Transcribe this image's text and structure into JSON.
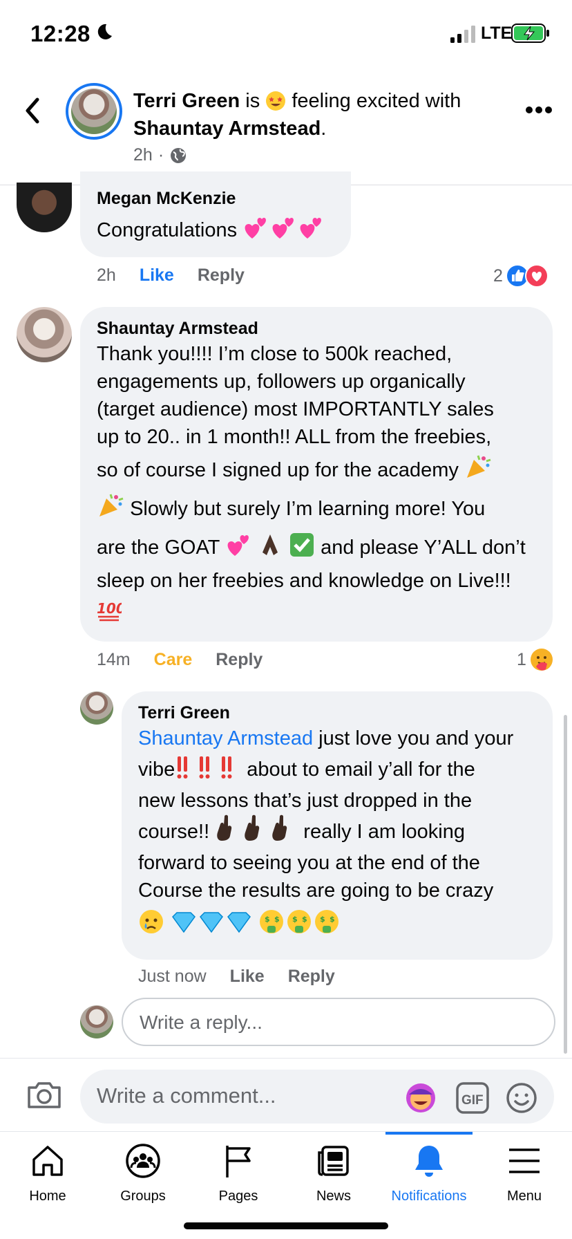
{
  "status_bar": {
    "time": "12:28",
    "network": "LTE"
  },
  "header": {
    "author": "Terri Green",
    "connector": "is",
    "feeling": "feeling excited with",
    "tagged": "Shauntay Armstead",
    "meta_time": "2h",
    "dot": "·"
  },
  "comments": [
    {
      "name": "Megan McKenzie",
      "text": "Congratulations",
      "time": "2h",
      "like": "Like",
      "reply": "Reply",
      "reaction_count": "2"
    },
    {
      "name": "Shauntay Armstead",
      "lines": [
        "Thank you!!!! I’m close to 500k reached,",
        "engagements up, followers up organically",
        "(target audience) most IMPORTANTLY sales",
        "up to 20.. in 1 month!! ALL from the freebies,",
        "so of course I signed up for the academy",
        "Slowly but surely I’m learning more! You",
        "are the GOAT",
        "and please Y’ALL don’t",
        "sleep on her freebies and knowledge on Live!!!"
      ],
      "time": "14m",
      "reaction_label": "Care",
      "reply": "Reply",
      "reaction_count": "1"
    },
    {
      "name": "Terri Green",
      "mention": "Shauntay Armstead",
      "lines": [
        "just love you and your",
        "vibe",
        "about to email y’all for the",
        "new lessons that’s just dropped in the",
        "course!!",
        "really I am looking",
        "forward to seeing you at the end of the",
        "Course the results are going to be crazy"
      ],
      "time": "Just now",
      "like": "Like",
      "reply": "Reply"
    }
  ],
  "reply_placeholder": "Write a reply...",
  "comment_placeholder": "Write a comment...",
  "gif_label": "GIF",
  "tabs": [
    {
      "label": "Home",
      "icon": "home-icon"
    },
    {
      "label": "Groups",
      "icon": "groups-icon"
    },
    {
      "label": "Pages",
      "icon": "flag-icon"
    },
    {
      "label": "News",
      "icon": "news-icon"
    },
    {
      "label": "Notifications",
      "icon": "bell-icon"
    },
    {
      "label": "Menu",
      "icon": "menu-icon"
    }
  ],
  "colors": {
    "accent": "#1877f2",
    "care": "#f7b125",
    "bubble": "#f0f2f5"
  }
}
